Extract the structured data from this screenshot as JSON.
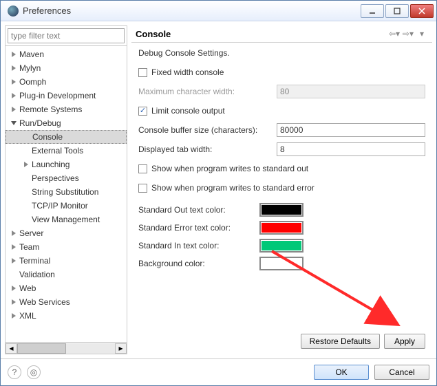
{
  "window": {
    "title": "Preferences"
  },
  "filter": {
    "placeholder": "type filter text"
  },
  "tree": [
    {
      "label": "Maven",
      "depth": 0,
      "exp": "closed"
    },
    {
      "label": "Mylyn",
      "depth": 0,
      "exp": "closed"
    },
    {
      "label": "Oomph",
      "depth": 0,
      "exp": "closed"
    },
    {
      "label": "Plug-in Development",
      "depth": 0,
      "exp": "closed"
    },
    {
      "label": "Remote Systems",
      "depth": 0,
      "exp": "closed"
    },
    {
      "label": "Run/Debug",
      "depth": 0,
      "exp": "open"
    },
    {
      "label": "Console",
      "depth": 1,
      "exp": "none",
      "sel": true
    },
    {
      "label": "External Tools",
      "depth": 1,
      "exp": "none"
    },
    {
      "label": "Launching",
      "depth": 1,
      "exp": "closed"
    },
    {
      "label": "Perspectives",
      "depth": 1,
      "exp": "none"
    },
    {
      "label": "String Substitution",
      "depth": 1,
      "exp": "none"
    },
    {
      "label": "TCP/IP Monitor",
      "depth": 1,
      "exp": "none"
    },
    {
      "label": "View Management",
      "depth": 1,
      "exp": "none"
    },
    {
      "label": "Server",
      "depth": 0,
      "exp": "closed"
    },
    {
      "label": "Team",
      "depth": 0,
      "exp": "closed"
    },
    {
      "label": "Terminal",
      "depth": 0,
      "exp": "closed"
    },
    {
      "label": "Validation",
      "depth": 0,
      "exp": "none"
    },
    {
      "label": "Web",
      "depth": 0,
      "exp": "closed"
    },
    {
      "label": "Web Services",
      "depth": 0,
      "exp": "closed"
    },
    {
      "label": "XML",
      "depth": 0,
      "exp": "closed"
    }
  ],
  "page": {
    "title": "Console",
    "desc": "Debug Console Settings.",
    "fixed_width": {
      "label": "Fixed width console",
      "checked": false
    },
    "max_char": {
      "label": "Maximum character width:",
      "value": "80",
      "disabled": true
    },
    "limit": {
      "label": "Limit console output",
      "checked": true
    },
    "buf": {
      "label": "Console buffer size (characters):",
      "value": "80000"
    },
    "tab": {
      "label": "Displayed tab width:",
      "value": "8"
    },
    "show_out": {
      "label": "Show when program writes to standard out",
      "checked": false
    },
    "show_err": {
      "label": "Show when program writes to standard error",
      "checked": false
    },
    "colors": [
      {
        "label": "Standard Out text color:",
        "value": "#000000"
      },
      {
        "label": "Standard Error text color:",
        "value": "#ff0000"
      },
      {
        "label": "Standard In text color:",
        "value": "#00c878"
      },
      {
        "label": "Background color:",
        "value": "#ffffff"
      }
    ],
    "restore": "Restore Defaults",
    "apply": "Apply"
  },
  "buttons": {
    "ok": "OK",
    "cancel": "Cancel"
  }
}
